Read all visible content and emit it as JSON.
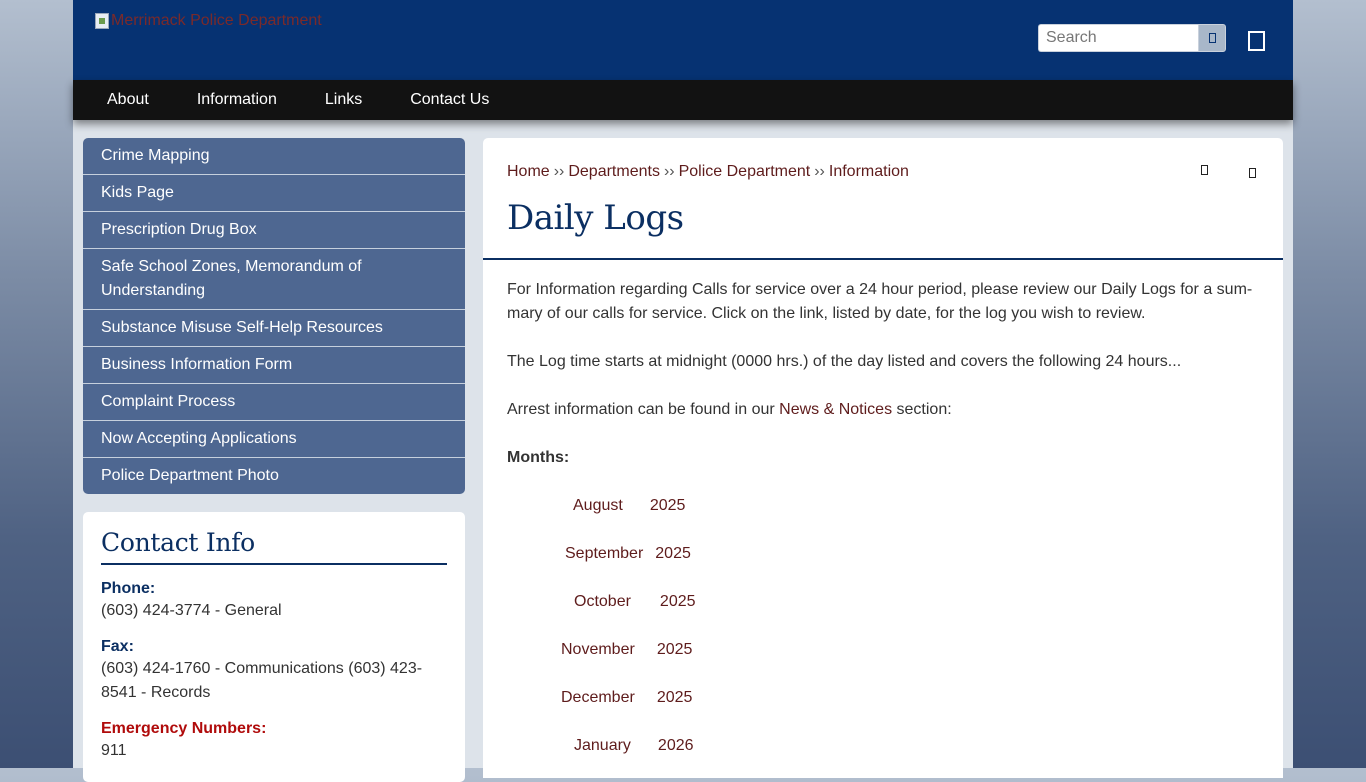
{
  "header": {
    "logo_alt": "Merrimack Police Department",
    "search_placeholder": "Search"
  },
  "nav": [
    "About",
    "Information",
    "Links",
    "Contact Us"
  ],
  "sidebar": {
    "items": [
      "Crime Mapping",
      "Kids Page",
      "Prescription Drug Box",
      "Safe School Zones, Memorandum of Understanding",
      "Substance Misuse Self-Help Resources",
      "Business Information Form",
      "Complaint Process",
      "Now Accepting Applications",
      "Police Department Photo"
    ]
  },
  "contact": {
    "title": "Contact Info",
    "phone_label": "Phone:",
    "phone_value": "(603) 424-3774 - General",
    "fax_label": "Fax:",
    "fax_value": "(603) 424-1760 - Communications (603) 423-8541 - Records",
    "emergency_label": "Emergency Numbers:",
    "emergency_value": "911"
  },
  "breadcrumb": {
    "items": [
      "Home",
      "Departments",
      "Police Department",
      "Information"
    ],
    "separator": "››"
  },
  "page_title": "Daily Logs",
  "content": {
    "para1": "For Information regarding Calls for service over a 24 hour period, please review our Daily Logs for a sum­mary of our calls for service.  Click on the link, listed by date, for the log you wish to review.",
    "para2": "The Log time starts at midnight (0000 hrs.) of the day listed and covers the following 24 hours...",
    "para3_before": "Arrest information can be found in our ",
    "para3_link": "News & Notices",
    "para3_after": " section:",
    "months_label": "Months:",
    "months": [
      {
        "month": "August",
        "year": "2025"
      },
      {
        "month": "September",
        "year": "2025"
      },
      {
        "month": "October",
        "year": "2025"
      },
      {
        "month": "November",
        "year": "2025"
      },
      {
        "month": "December",
        "year": "2025"
      },
      {
        "month": "January",
        "year": "2026"
      }
    ]
  },
  "colors": {
    "header_bg": "#063272",
    "nav_bg": "#121212",
    "sidebar_bg": "#4e6791",
    "title": "#0b2f62",
    "link": "#5e1c1c",
    "emergency": "#b00b0b"
  }
}
